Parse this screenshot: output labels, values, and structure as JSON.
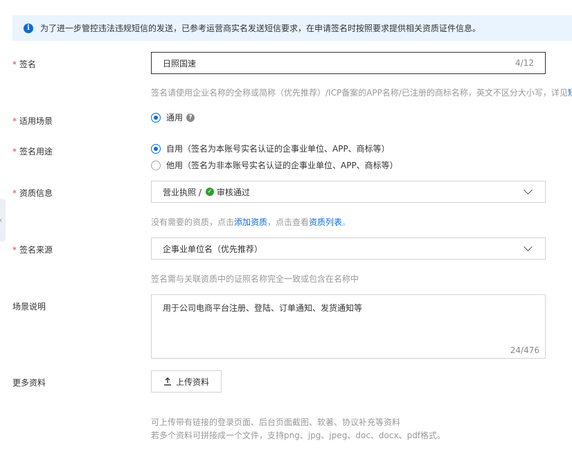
{
  "notice": {
    "text": "为了进一步管控违法违规短信的发送，已参考运营商实名发送短信要求，在申请签名时按照要求提供相关资质证件信息。"
  },
  "signature": {
    "required_mark": "*",
    "label": "签名",
    "value": "日照国速",
    "count": "4/12",
    "hint": "签名请使用企业名称的全称或简称（优先推荐）/ICP备案的APP名称/已注册的商标名称，英文不区分大小写，详见",
    "hint_link": "短"
  },
  "scene": {
    "required_mark": "*",
    "label": "适用场景",
    "option": "通用",
    "help_icon": "?"
  },
  "usage": {
    "required_mark": "*",
    "label": "签名用途",
    "option1": "自用（签名为本账号实名认证的企事业单位、APP、商标等）",
    "option2": "他用（签名为非本账号实名认证的企事业单位、APP、商标等）"
  },
  "qualification": {
    "required_mark": "*",
    "label": "资质信息",
    "value_prefix": "营业执照 /",
    "status": "审核通过",
    "hint_before": "没有需要的资质，点击",
    "hint_link1": "添加资质",
    "hint_middle": "，点击查看",
    "hint_link2": "资质列表",
    "hint_end": "。"
  },
  "source": {
    "required_mark": "*",
    "label": "签名来源",
    "value": "企事业单位名（优先推荐）",
    "hint": "签名需与关联资质中的证照名称完全一致或包含在名称中"
  },
  "description": {
    "label": "场景说明",
    "value": "用于公司电商平台注册、登陆、订单通知、发货通知等",
    "count": "24/476"
  },
  "more": {
    "label": "更多资料",
    "upload_label": "上传资料",
    "hint1": "可上传带有链接的登录页面、后台页面截图、软著、协议补充等资料",
    "hint2": "若多个资料可拼接成一个文件，支持png、jpg、jpeg、doc、docx、pdf格式。"
  },
  "edge_tab": {
    "glyph": "‹"
  },
  "icons": {
    "info": "info-icon",
    "help": "help-icon",
    "check": "check-circle-icon",
    "chevron": "chevron-down-icon",
    "upload": "upload-icon"
  },
  "colors": {
    "accent": "#0a6dd8",
    "required": "#e0473f",
    "success": "#2ca02c",
    "notice_bg": "#eaf4fe"
  }
}
